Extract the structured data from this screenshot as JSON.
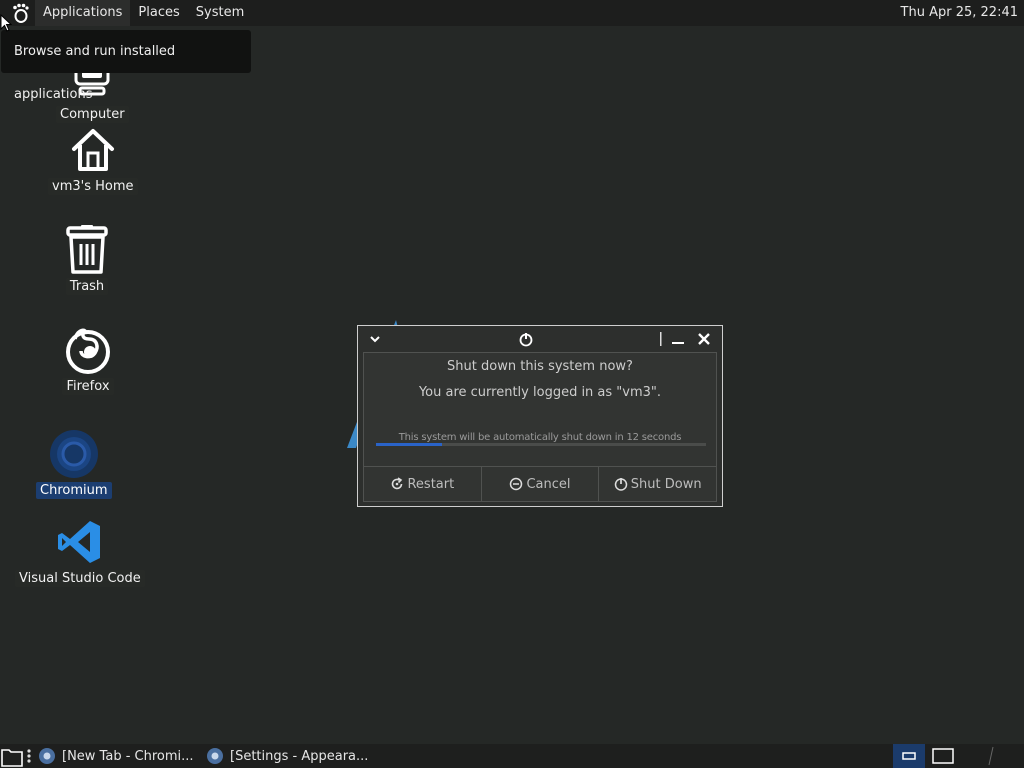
{
  "topbar": {
    "menus": [
      "Applications",
      "Places",
      "System"
    ],
    "clock": "Thu Apr 25, 22:41"
  },
  "tooltip": "Browse and run installed applications",
  "desktop": {
    "icons": [
      {
        "label": "Computer",
        "icon": "computer-icon"
      },
      {
        "label": "vm3's Home",
        "icon": "home-icon"
      },
      {
        "label": "Trash",
        "icon": "trash-icon"
      },
      {
        "label": "Firefox",
        "icon": "firefox-icon"
      },
      {
        "label": "Chromium",
        "icon": "chromium-icon",
        "selected": true
      },
      {
        "label": "Visual Studio Code",
        "icon": "vscode-icon"
      }
    ]
  },
  "dialog": {
    "question": "Shut down this system now?",
    "logged_in": "You are currently logged in as \"vm3\".",
    "countdown": "This system will be automatically shut down in 12 seconds",
    "progress": 0.2,
    "buttons": {
      "restart": "Restart",
      "cancel": "Cancel",
      "shutdown": "Shut Down"
    }
  },
  "taskbar": {
    "tasks": [
      {
        "label": "[New Tab - Chromi..."
      },
      {
        "label": "[Settings - Appeara..."
      }
    ]
  },
  "colors": {
    "desktop_bg": "#252826",
    "accent": "#2a63c8",
    "selection": "#1c3e71"
  }
}
